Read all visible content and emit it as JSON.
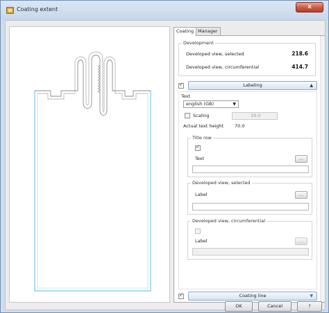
{
  "window": {
    "title": "Coating extent",
    "close_glyph": "x"
  },
  "tabs": [
    {
      "label": "Coating",
      "active": true
    },
    {
      "label": "Manager",
      "active": false
    }
  ],
  "development": {
    "legend": "Development",
    "selected_label": "Developed view, selected",
    "selected_value": "218.6",
    "circ_label": "Developed view, circumferential",
    "circ_value": "414.7"
  },
  "labeling": {
    "enabled": true,
    "button_label": "Labeling",
    "expanded": true,
    "text_group": {
      "legend": "Text",
      "language": "english (GB)",
      "scaling_label": "Scaling",
      "scaling_checked": false,
      "scaling_value": "20.0",
      "actual_height_label": "Actual text height",
      "actual_height_value": "70.0"
    },
    "title_row": {
      "legend": "Title row",
      "checked": true,
      "field_label": "Text",
      "browse_label": "...",
      "value": ""
    },
    "dev_selected": {
      "legend": "Developed view, selected",
      "field_label": "Label",
      "browse_label": "...",
      "value": ""
    },
    "dev_circ": {
      "legend": "Developed view, circumferential",
      "checked": false,
      "field_label": "Label",
      "browse_label": "...",
      "value": ""
    }
  },
  "coating_line": {
    "enabled": true,
    "button_label": "Coating line",
    "expanded": false
  },
  "buttons": {
    "ok": "OK",
    "cancel": "Cancel",
    "help": "?"
  },
  "icons": {
    "app": "coating-app-icon",
    "expand_up": "▲",
    "expand_down": "▼",
    "combo_caret": "▼"
  },
  "colors": {
    "outline": "#7cc3e8",
    "profile": "#8a8a8a"
  }
}
